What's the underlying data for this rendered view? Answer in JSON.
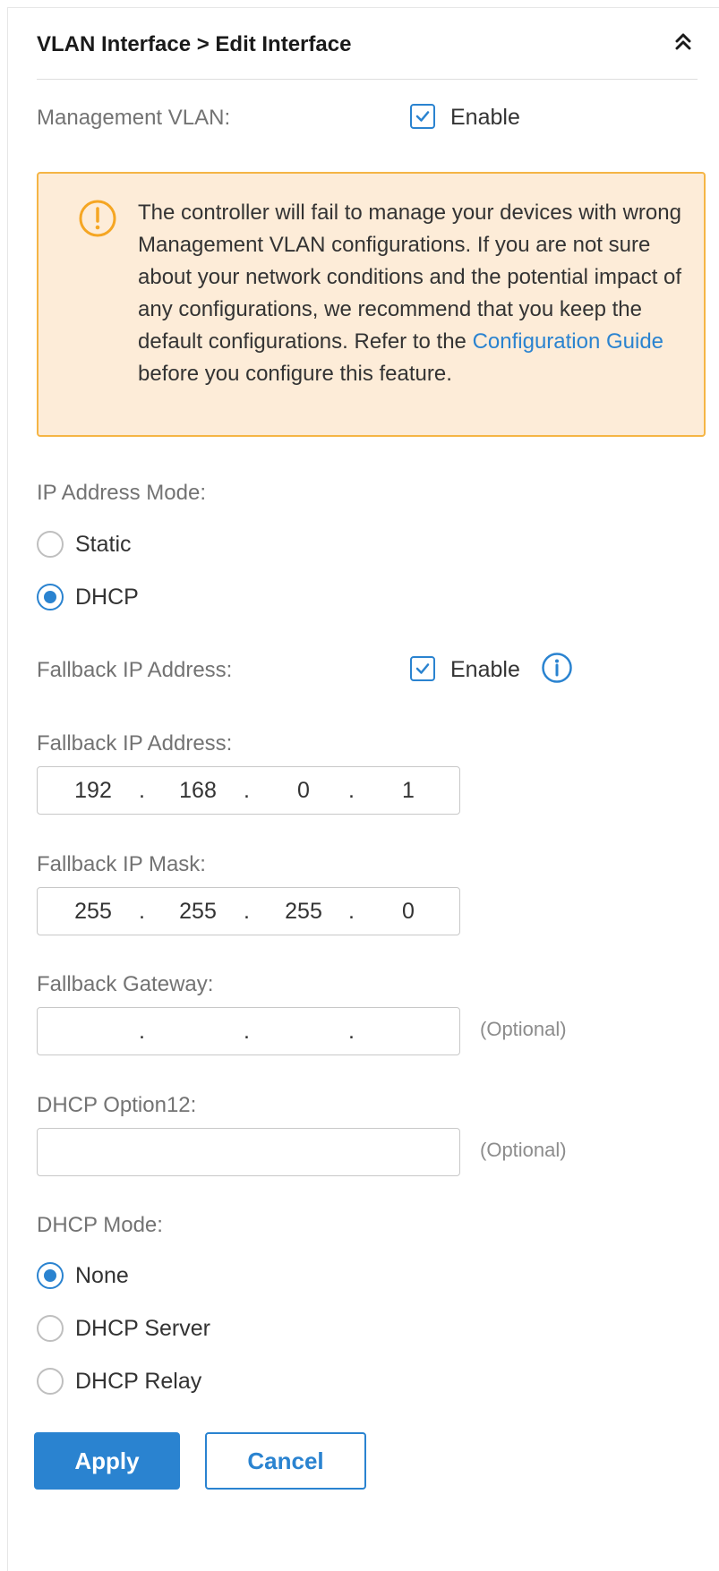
{
  "header": {
    "title": "VLAN Interface > Edit Interface",
    "collapse_icon": "chevron-double-up-icon"
  },
  "management_vlan": {
    "label": "Management VLAN:",
    "enable_label": "Enable",
    "checked": true
  },
  "warning": {
    "icon": "warning-circle-icon",
    "text_before_link": "The controller will fail to manage your devices with wrong Management VLAN configurations. If you are not sure about your network conditions and the potential impact of any configurations, we recommend that you keep the default configurations. Refer to the ",
    "link_text": "Configuration Guide",
    "text_after_link": " before you configure this feature.",
    "colors": {
      "background": "#fdecd8",
      "border": "#f5b545"
    }
  },
  "ip_mode": {
    "label": "IP Address Mode:",
    "options": [
      {
        "label": "Static",
        "selected": false
      },
      {
        "label": "DHCP",
        "selected": true
      }
    ]
  },
  "fallback_enable": {
    "label": "Fallback IP Address:",
    "enable_label": "Enable",
    "checked": true,
    "info_icon": "info-icon"
  },
  "fallback_ip": {
    "label": "Fallback IP Address:",
    "octets": [
      "192",
      "168",
      "0",
      "1"
    ]
  },
  "fallback_mask": {
    "label": "Fallback IP Mask:",
    "octets": [
      "255",
      "255",
      "255",
      "0"
    ]
  },
  "fallback_gateway": {
    "label": "Fallback Gateway:",
    "octets": [
      "",
      "",
      "",
      ""
    ],
    "hint": "(Optional)"
  },
  "dhcp_option12": {
    "label": "DHCP Option12:",
    "value": "",
    "hint": "(Optional)"
  },
  "dhcp_mode": {
    "label": "DHCP Mode:",
    "options": [
      {
        "label": "None",
        "selected": true
      },
      {
        "label": "DHCP Server",
        "selected": false
      },
      {
        "label": "DHCP Relay",
        "selected": false
      }
    ]
  },
  "buttons": {
    "apply": "Apply",
    "cancel": "Cancel"
  },
  "colors": {
    "accent": "#2a83d0",
    "label": "#737373"
  }
}
